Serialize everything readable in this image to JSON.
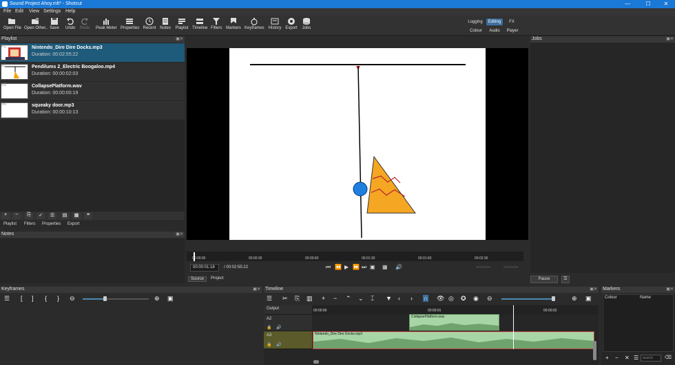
{
  "window": {
    "title": "Sound Project Ahoy.mlt* - Shotcut",
    "minimize": "—",
    "maximize": "☐",
    "close": "✕"
  },
  "menu": [
    "File",
    "Edit",
    "View",
    "Settings",
    "Help"
  ],
  "toolbar": [
    {
      "label": "Open File",
      "icon": "folder-icon"
    },
    {
      "label": "Open Other..",
      "icon": "open-other-icon"
    },
    {
      "label": "Save",
      "icon": "save-icon"
    },
    {
      "label": "Undo",
      "icon": "undo-icon"
    },
    {
      "label": "Redo",
      "icon": "redo-icon"
    },
    {
      "label": "Peak Meter",
      "icon": "peak-meter-icon"
    },
    {
      "label": "Properties",
      "icon": "properties-icon"
    },
    {
      "label": "Recent",
      "icon": "recent-icon"
    },
    {
      "label": "Notes",
      "icon": "notes-icon"
    },
    {
      "label": "Playlist",
      "icon": "playlist-icon"
    },
    {
      "label": "Timeline",
      "icon": "timeline-icon"
    },
    {
      "label": "Filters",
      "icon": "filter-icon"
    },
    {
      "label": "Markers",
      "icon": "markers-icon"
    },
    {
      "label": "Keyframes",
      "icon": "keyframes-icon"
    },
    {
      "label": "History",
      "icon": "history-icon"
    },
    {
      "label": "Export",
      "icon": "export-icon"
    },
    {
      "label": "Jobs",
      "icon": "jobs-icon"
    }
  ],
  "layouts": {
    "row1": [
      "Logging",
      "Editing",
      "FX"
    ],
    "row2": [
      "Colour",
      "Audio",
      "Player"
    ],
    "active": "Editing",
    "active_color": "#3d6f9e"
  },
  "playlist": {
    "title": "Playlist",
    "items": [
      {
        "num": "#1",
        "name": "Nintendo_Dire Dire Docks.mp3",
        "duration": "Duration: 00:02:55:22"
      },
      {
        "num": "#2",
        "name": "Pendilums 2_Electric Boogaloo.mp4",
        "duration": "Duration: 00:00:02:03"
      },
      {
        "num": "#3",
        "name": "CollapsePlatform.wav",
        "duration": "Duration: 00:00:00:19"
      },
      {
        "num": "#4",
        "name": "squeaky door.mp3",
        "duration": "Duration: 00:00:10:13"
      }
    ],
    "tabs": [
      "Playlist",
      "Filters",
      "Properties",
      "Export"
    ]
  },
  "notes": {
    "title": "Notes"
  },
  "jobs": {
    "title": "Jobs",
    "pause_label": "Pause",
    "menu_label": "☰"
  },
  "player": {
    "ruler_ticks": [
      "00:00:00",
      "00:00:30",
      "00:00:60",
      "00:01:30",
      "00:01:60",
      "00:02:30"
    ],
    "position": "00:00:01:18",
    "total": "/ 00:02:55:22",
    "in_point": "--:--:--:--",
    "out_point": "--:--:--:--",
    "tabs": [
      "Source",
      "Project"
    ],
    "active_tab": "Source"
  },
  "keyframes": {
    "title": "Keyframes"
  },
  "timeline": {
    "title": "Timeline",
    "ruler": [
      "00:00:00",
      "00:00:01",
      "00:00:02"
    ],
    "tracks": [
      {
        "name": "Output"
      },
      {
        "name": "A2"
      },
      {
        "name": "A3"
      }
    ],
    "clips": [
      {
        "label": "CollapsePlatform.wav",
        "track": "A2"
      },
      {
        "label": "Nintendo_Dire Dire Docks.mp3",
        "track": "A3"
      }
    ],
    "clip_color": "#a8d5a6"
  },
  "markers": {
    "title": "Markers",
    "columns": [
      "Colour",
      "Name"
    ],
    "search_placeholder": "search"
  },
  "accent": "#1a78d6"
}
